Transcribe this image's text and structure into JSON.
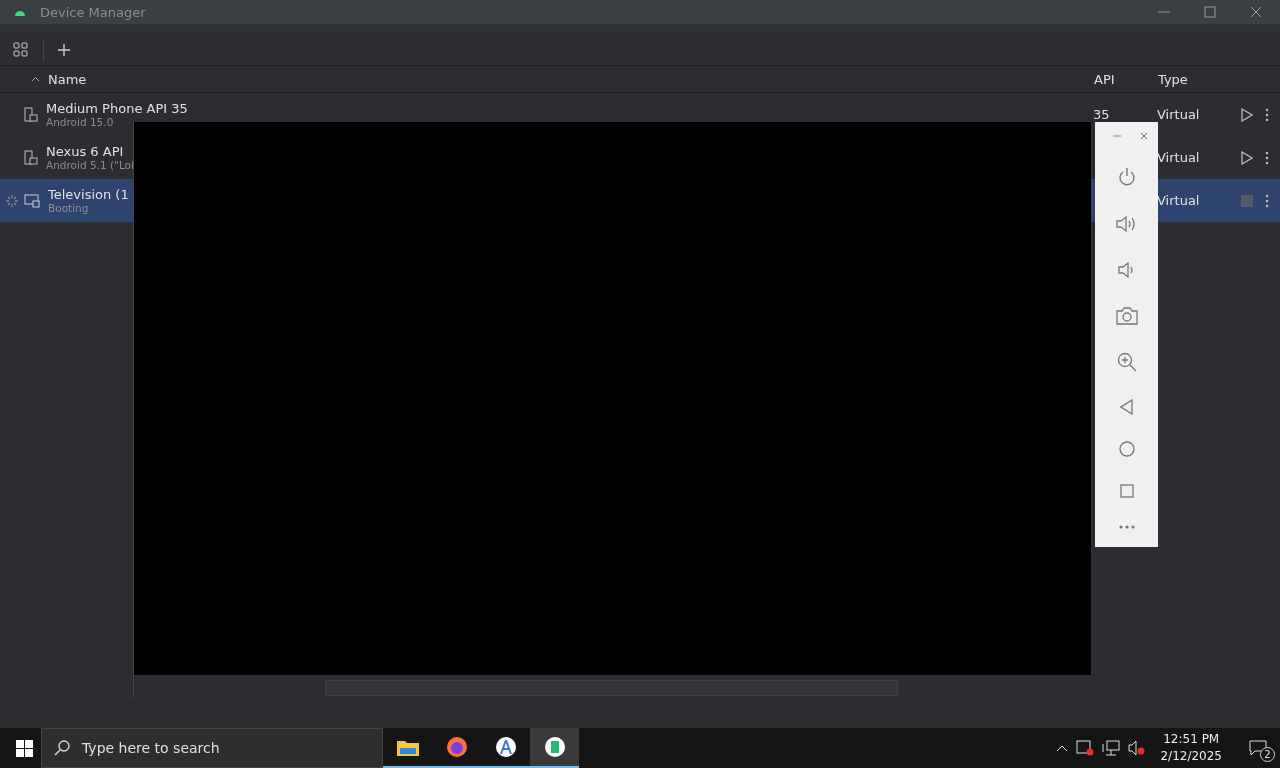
{
  "window": {
    "title": "Device Manager"
  },
  "columns": [
    "Name",
    "API",
    "Type"
  ],
  "devices": [
    {
      "name": "Medium Phone API 35",
      "subtitle": "Android 15.0",
      "api": "35",
      "type": "Virtual",
      "kind": "phone",
      "running": false,
      "selected": false
    },
    {
      "name": "Nexus 6 API",
      "subtitle": "Android 5.1 (\"Loi",
      "type": "Virtual",
      "kind": "phone",
      "running": false,
      "selected": false
    },
    {
      "name": "Television (1",
      "subtitle": "Booting",
      "type": "Virtual",
      "kind": "tv",
      "running": true,
      "selected": true
    }
  ],
  "emulator_toolbar": [
    {
      "kind": "power"
    },
    {
      "kind": "volume-up"
    },
    {
      "kind": "volume-down"
    },
    {
      "kind": "camera"
    },
    {
      "kind": "zoom"
    },
    {
      "kind": "back"
    },
    {
      "kind": "home"
    },
    {
      "kind": "overview"
    },
    {
      "kind": "more"
    }
  ],
  "taskbar": {
    "search_placeholder": "Type here to search",
    "apps": [
      {
        "kind": "explorer",
        "selected": false
      },
      {
        "kind": "firefox",
        "selected": false
      },
      {
        "kind": "studio",
        "selected": false
      },
      {
        "kind": "emulator",
        "selected": true
      }
    ],
    "time": "12:51 PM",
    "date": "2/12/2025",
    "notifications": "2"
  }
}
